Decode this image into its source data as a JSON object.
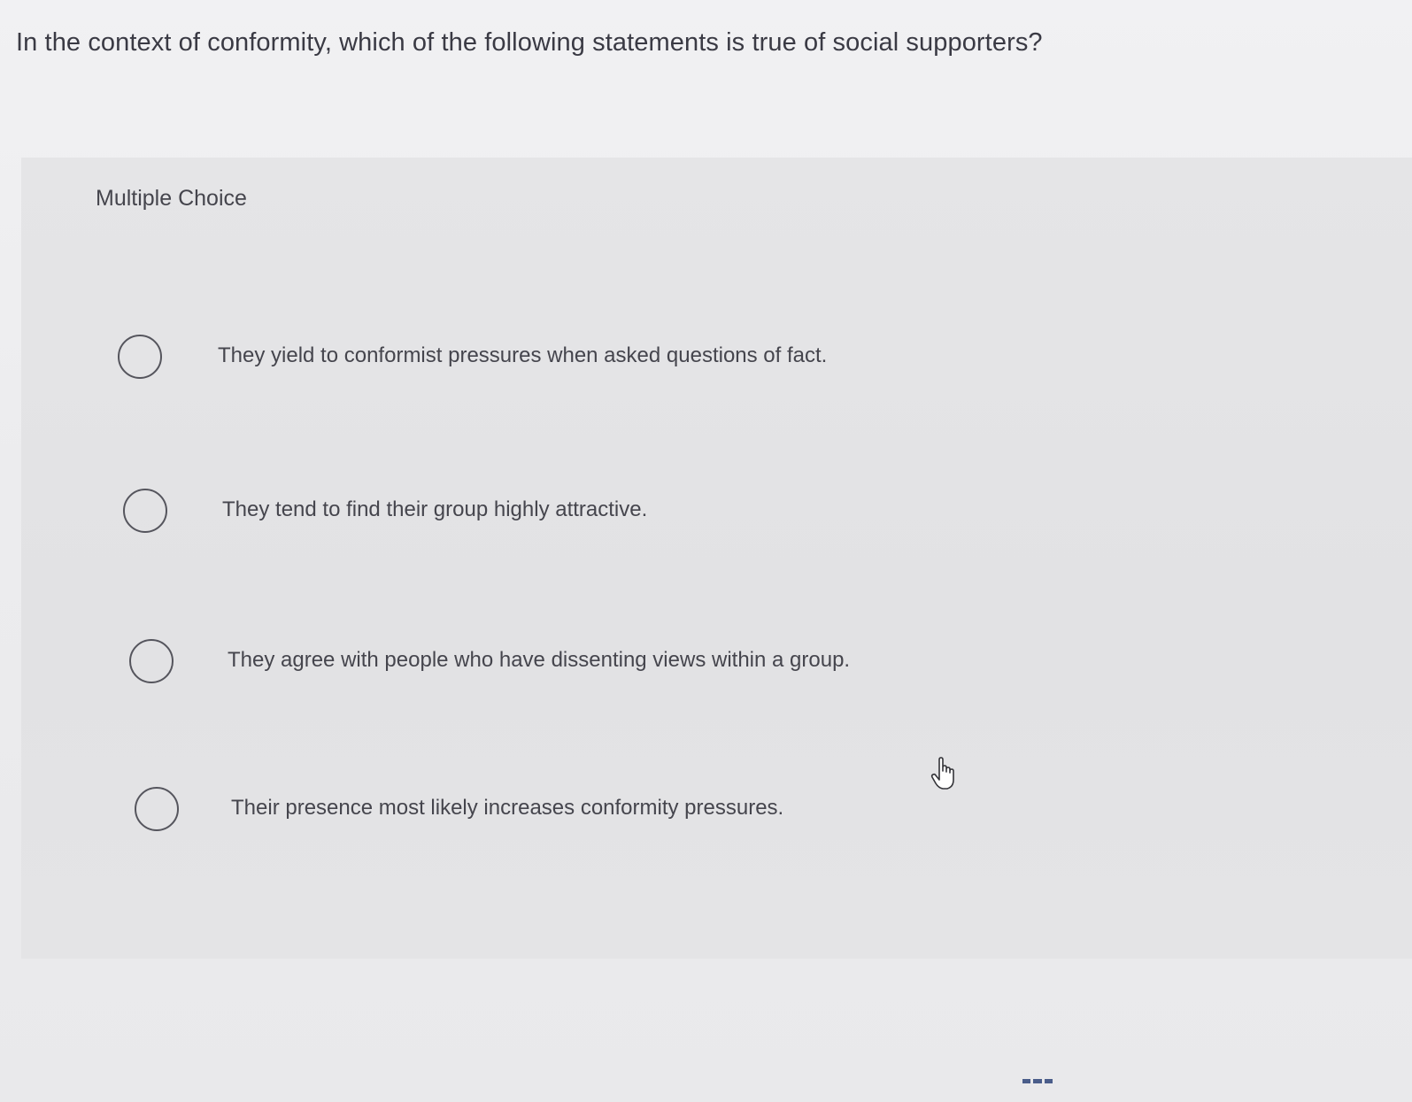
{
  "question": {
    "text": "In the context of conformity, which of the following statements is true of social supporters?"
  },
  "panel": {
    "label": "Multiple Choice"
  },
  "options": [
    {
      "text": "They yield to conformist pressures when asked questions of fact.",
      "selected": false
    },
    {
      "text": "They tend to find their group highly attractive.",
      "selected": false
    },
    {
      "text": "They agree with people who have dissenting views within a group.",
      "selected": false
    },
    {
      "text": "Their presence most likely increases conformity pressures.",
      "selected": false
    }
  ],
  "cursor": {
    "icon": "hand-pointer-icon"
  }
}
